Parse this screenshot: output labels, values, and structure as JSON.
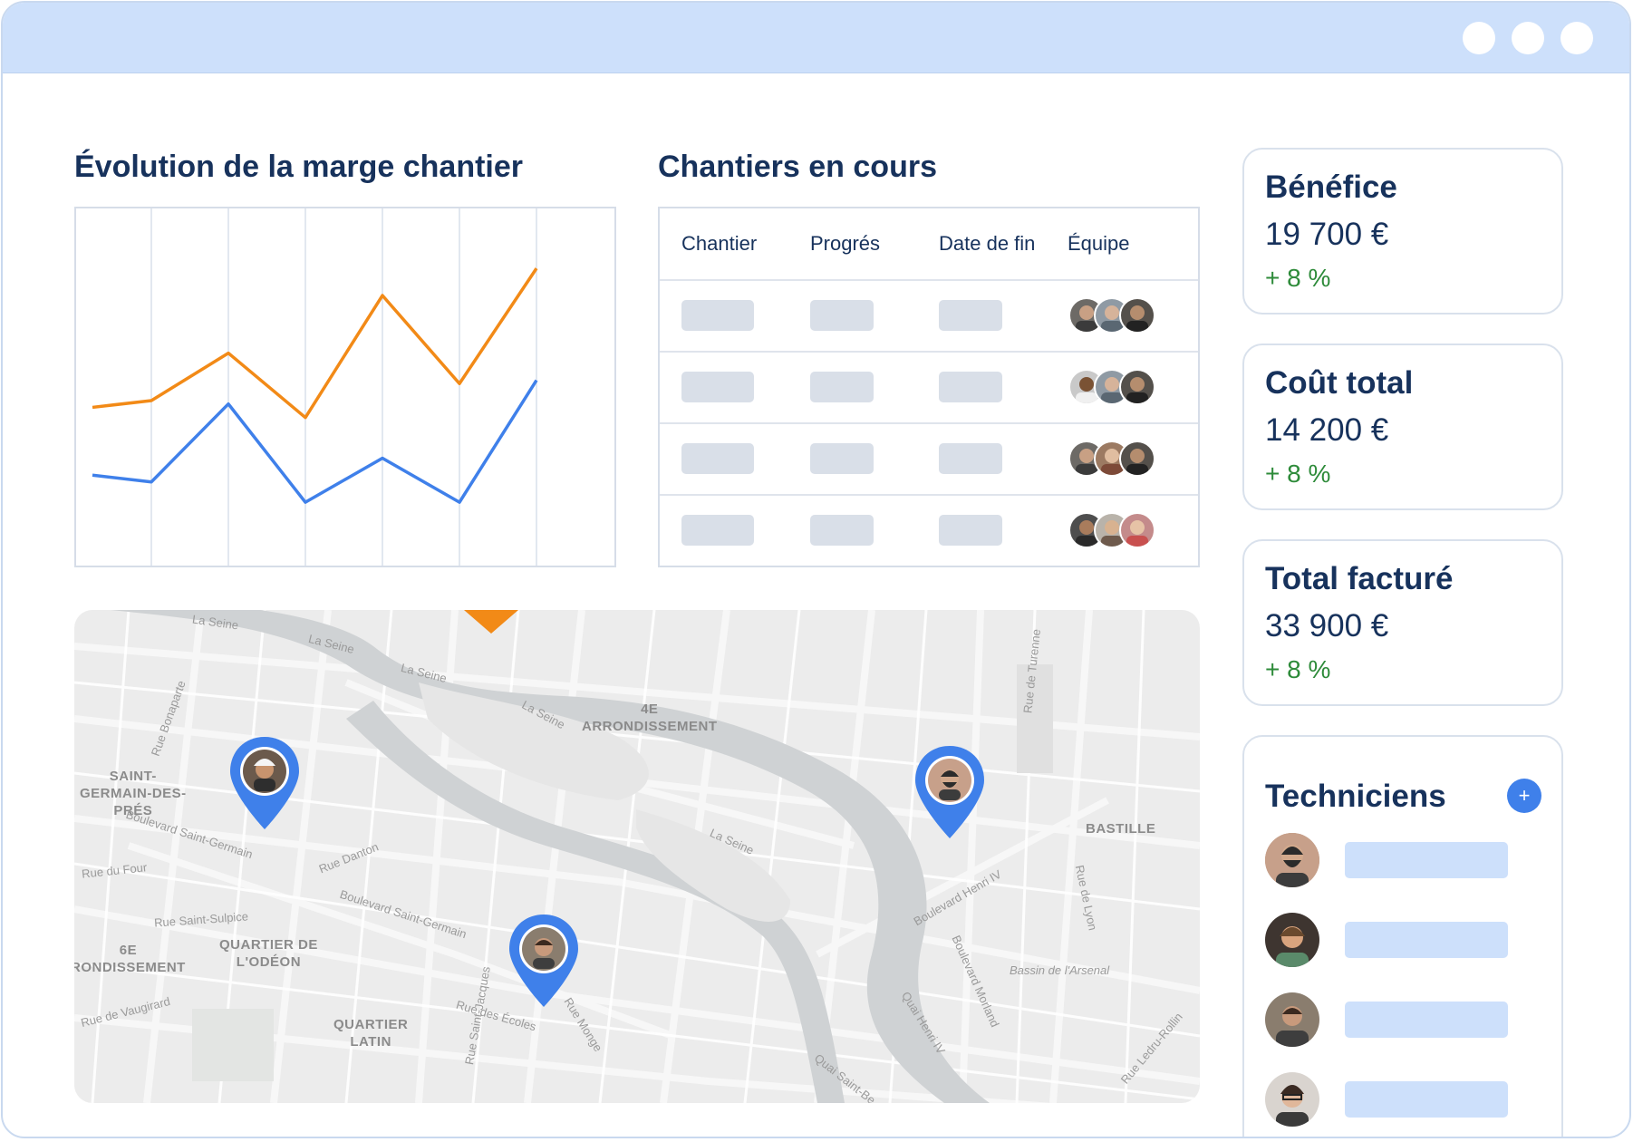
{
  "chart_section": {
    "title": "Évolution de la marge chantier"
  },
  "chart_data": {
    "type": "line",
    "title": "Évolution de la marge chantier",
    "x": [
      0,
      1,
      2,
      3,
      4,
      5,
      6
    ],
    "ylim": [
      0,
      100
    ],
    "grid": true,
    "series": [
      {
        "color": "#f28a17",
        "values": [
          44,
          46,
          60,
          41,
          77,
          51,
          85
        ]
      },
      {
        "color": "#3f80ea",
        "values": [
          24,
          22,
          45,
          16,
          29,
          16,
          52
        ]
      }
    ]
  },
  "table_section": {
    "title": "Chantiers en cours",
    "columns": [
      "Chantier",
      "Progrés",
      "Date de fin",
      "Équipe"
    ],
    "row_count_label": ""
  },
  "kpis": [
    {
      "label": "Bénéfice",
      "value": "19 700 €",
      "delta": "+ 8 %"
    },
    {
      "label": "Coût total",
      "value": "14 200 €",
      "delta": "+ 8 %"
    },
    {
      "label": "Total facturé",
      "value": "33 900 €",
      "delta": "+ 8 %"
    }
  ],
  "technicians": {
    "title": "Techniciens",
    "add_icon": "plus-icon"
  },
  "map": {
    "districts": [
      {
        "text": "4E\nARRONDISSEMENT"
      },
      {
        "text": "SAINT-\nGERMAIN-DES-\nPRÉS"
      },
      {
        "text": "BASTILLE"
      },
      {
        "text": "6E\nRONDISSEMENT"
      },
      {
        "text": "QUARTIER DE\nL'ODÉON"
      },
      {
        "text": "QUARTIER\nLATIN"
      }
    ],
    "streets": [
      "La Seine",
      "La Seine",
      "La Seine",
      "La Seine",
      "La Seine",
      "Boulevard Saint-Germain",
      "Boulevard Saint-Germain",
      "Rue du Four",
      "Rue Saint-Sulpice",
      "Rue de Vaugirard",
      "Rue des Écoles",
      "Rue Monge",
      "Rue Saint-Jacques",
      "Rue Danton",
      "Boulevard Henri IV",
      "Quai Henri IV",
      "Boulevard Morland",
      "Rue de Lyon",
      "Bassin de l'Arsenal",
      "Rue Ledru-Rollin",
      "Quai Saint-Be",
      "Rue de Turenne",
      "Rue Bonaparte"
    ],
    "colors": {
      "pin": "#3f80ea",
      "marker": "#f28a17"
    }
  }
}
